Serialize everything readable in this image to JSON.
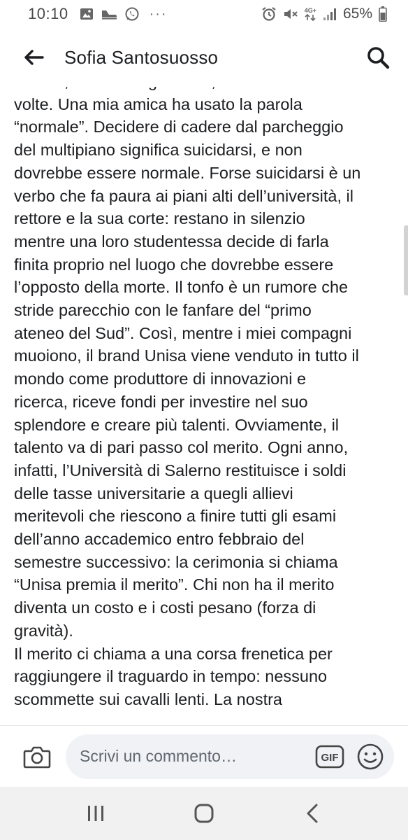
{
  "status_bar": {
    "time": "10:10",
    "dots": "···",
    "network": "4G+",
    "battery": "65%"
  },
  "header": {
    "title": "Sofia Santosuosso",
    "back_icon": "arrow-left-icon",
    "search_icon": "search-icon"
  },
  "post": {
    "lines": [
      "cadere, succede ogni anno, anche due o tre",
      "volte. Una mia amica ha usato la parola",
      "“normale”. Decidere di cadere dal parcheggio",
      "del multipiano significa suicidarsi, e non",
      "dovrebbe essere normale. Forse suicidarsi è un",
      "verbo che fa paura ai piani alti dell’università, il",
      "rettore e la sua corte: restano in silenzio",
      "mentre una loro studentessa decide di farla",
      "finita proprio nel luogo che dovrebbe essere",
      "l’opposto della morte. Il tonfo è un rumore che",
      "stride parecchio con le fanfare del “primo",
      "ateneo del Sud”. Così, mentre i miei compagni",
      "muoiono, il brand Unisa viene venduto in tutto il",
      "mondo come produttore di innovazioni e",
      "ricerca, riceve fondi per investire nel suo",
      "splendore e creare più talenti. Ovviamente, il",
      "talento va di pari passo col merito. Ogni anno,",
      "infatti, l’Università di Salerno restituisce i soldi",
      "delle tasse universitarie a quegli allievi",
      "meritevoli che riescono a finire tutti gli esami",
      "dell’anno accademico entro febbraio del",
      "semestre successivo: la cerimonia si chiama",
      "“Unisa premia il merito”. Chi non ha il merito",
      "diventa un costo e i costi pesano (forza di",
      "gravità).",
      "Il merito ci chiama a una corsa frenetica per",
      "raggiungere il traguardo in tempo: nessuno",
      "scommette sui cavalli lenti. La nostra"
    ]
  },
  "comment_bar": {
    "placeholder": "Scrivi un commento…",
    "gif_label": "GIF",
    "camera_icon": "camera-icon",
    "emoji_icon": "smiley-icon"
  },
  "nav_bar": {
    "recents_icon": "recents-icon",
    "home_icon": "home-icon",
    "back_icon": "nav-back-icon"
  },
  "colors": {
    "text": "#1c1e21",
    "comment_field_bg": "#f0f2f5",
    "placeholder": "#606770",
    "nav_bg": "#f1f1f1",
    "icon": "#444444"
  }
}
